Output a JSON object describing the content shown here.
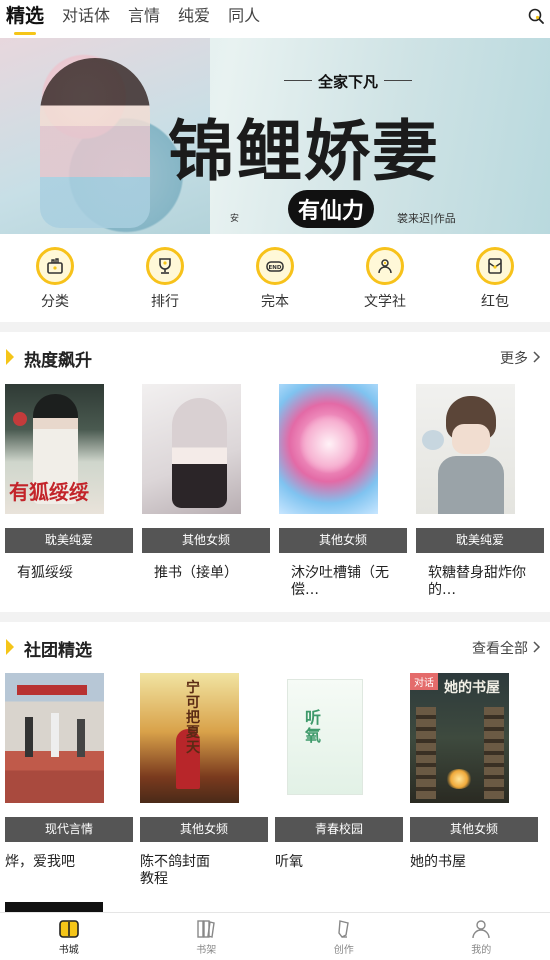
{
  "tabs": [
    "精选",
    "对话体",
    "言情",
    "纯爱",
    "同人"
  ],
  "banner": {
    "top_text": "全家下凡",
    "title": "锦鲤娇妻",
    "subtitle": "有仙力",
    "author": "裳来迟|作品",
    "small_tag": "安",
    "dots": 4
  },
  "categories": [
    {
      "label": "分类",
      "icon": "category-bag-icon"
    },
    {
      "label": "排行",
      "icon": "trophy-icon"
    },
    {
      "label": "完本",
      "icon": "end-tag-icon"
    },
    {
      "label": "文学社",
      "icon": "community-icon"
    },
    {
      "label": "红包",
      "icon": "red-envelope-icon"
    }
  ],
  "section_hot": {
    "title": "热度飙升",
    "more": "更多",
    "books": [
      {
        "genre": "耽美纯爱",
        "name": "有狐绥绥",
        "cover_text": "有狐绥绥"
      },
      {
        "genre": "其他女频",
        "name": "推书（接单）",
        "cover_text": ""
      },
      {
        "genre": "其他女频",
        "name": "沐汐吐槽铺（无偿…",
        "cover_text": ""
      },
      {
        "genre": "耽美纯爱",
        "name": "软糖替身甜炸你的…",
        "cover_text": ""
      }
    ]
  },
  "section_club": {
    "title": "社团精选",
    "more": "查看全部",
    "books": [
      {
        "genre": "现代言情",
        "name": "烨，爱我吧",
        "cover_text": ""
      },
      {
        "genre": "其他女频",
        "name": "陈不鸽封面教程",
        "cover_text": "宁可把夏天"
      },
      {
        "genre": "青春校园",
        "name": "听氧",
        "cover_text": "听氧"
      },
      {
        "genre": "其他女频",
        "name": "她的书屋",
        "cover_text": "她的书屋",
        "badge": "对话"
      }
    ]
  },
  "bottom_nav": [
    {
      "label": "书城",
      "icon": "bookstore-icon",
      "active": true
    },
    {
      "label": "书架",
      "icon": "bookshelf-icon",
      "active": false
    },
    {
      "label": "创作",
      "icon": "pen-icon",
      "active": false
    },
    {
      "label": "我的",
      "icon": "profile-icon",
      "active": false
    }
  ],
  "colors": {
    "accent": "#f5c518",
    "genre_bg": "#555555"
  }
}
